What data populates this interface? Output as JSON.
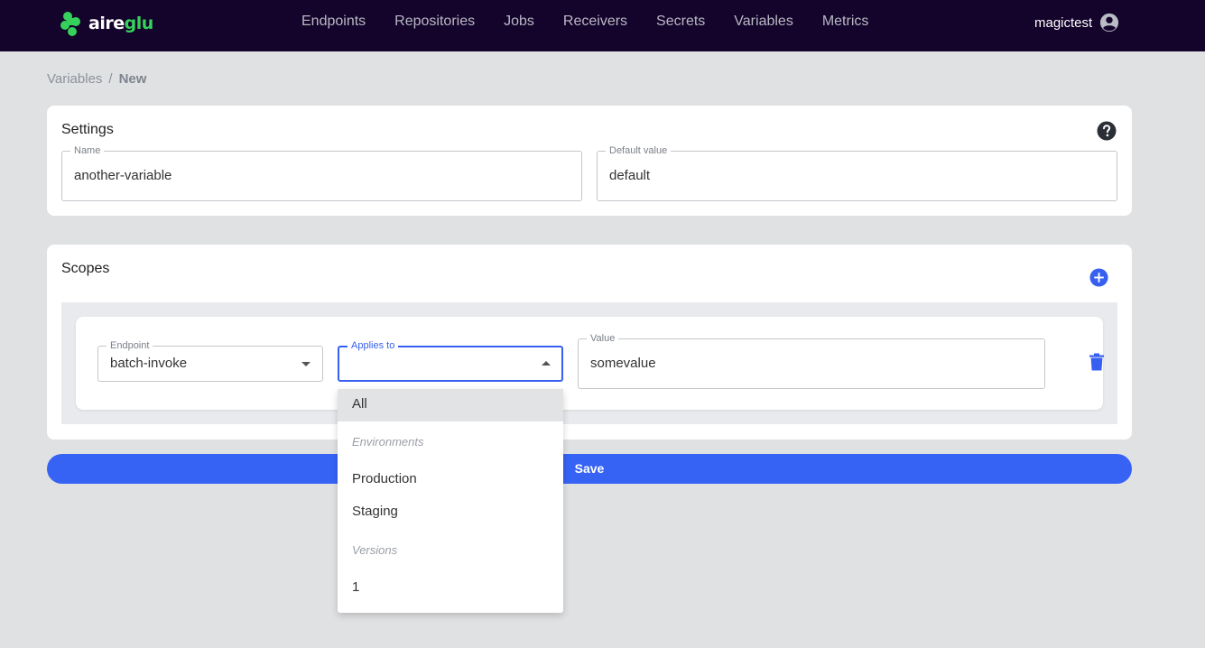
{
  "app": {
    "logo_text_a": "aire",
    "logo_text_b": "glu",
    "brand_color": "#36d15a",
    "nav_bg": "#14032a"
  },
  "nav": {
    "items": [
      "Endpoints",
      "Repositories",
      "Jobs",
      "Receivers",
      "Secrets",
      "Variables",
      "Metrics"
    ]
  },
  "user": {
    "name": "magictest",
    "icon": "account-circle-icon"
  },
  "breadcrumb": {
    "parent": "Variables",
    "separator": "/",
    "current": "New"
  },
  "settings": {
    "title": "Settings",
    "name_label": "Name",
    "name_value": "another-variable",
    "default_label": "Default value",
    "default_value": "default",
    "help_icon": "help-circle-icon"
  },
  "scopes": {
    "title": "Scopes",
    "add_icon": "add-circle-icon",
    "row": {
      "endpoint_label": "Endpoint",
      "endpoint_value": "batch-invoke",
      "applies_label": "Applies to",
      "applies_value": "",
      "value_label": "Value",
      "value_value": "somevalue",
      "delete_icon": "trash-icon"
    }
  },
  "save": {
    "label": "Save",
    "color": "#3763f5"
  },
  "menu": {
    "item_all": "All",
    "group_env": "Environments",
    "env_items": [
      "Production",
      "Staging"
    ],
    "group_versions": "Versions",
    "version_items": [
      "1"
    ]
  }
}
